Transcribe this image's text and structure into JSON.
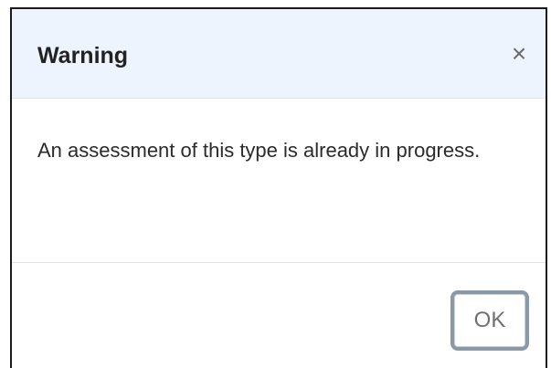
{
  "dialog": {
    "title": "Warning",
    "close_glyph": "×",
    "close_icon": "close-icon",
    "message": "An assessment of this type is already in progress.",
    "ok_label": "OK"
  },
  "colors": {
    "header_background": "#eef4fd",
    "button_border": "#8b98a5",
    "border": "#1a1a1a"
  }
}
